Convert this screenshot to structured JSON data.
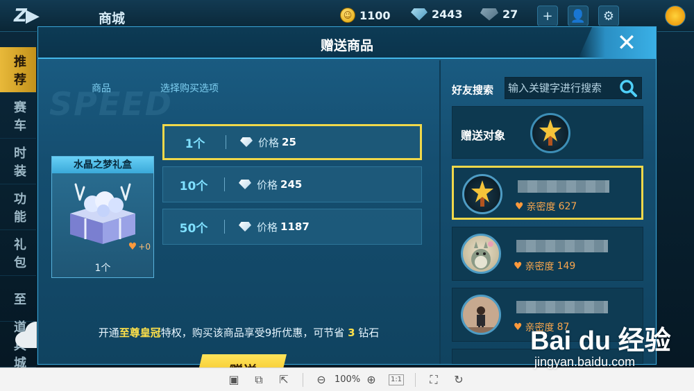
{
  "game": {
    "shop_title": "商城",
    "coins": "1100",
    "gems": "2443",
    "cards": "27",
    "left_menu": [
      "推荐",
      "赛车",
      "时装",
      "功能",
      "礼包",
      "至",
      "道具城"
    ]
  },
  "dialog": {
    "title": "赠送商品",
    "close_label": "✕",
    "col_item": "商品",
    "col_options": "选择购买选项",
    "item": {
      "name": "水晶之梦礼盒",
      "heart_bonus": "+0",
      "qty_label": "1个"
    },
    "options": [
      {
        "qty": "1个",
        "price_label": "价格",
        "price": "25",
        "selected": true
      },
      {
        "qty": "10个",
        "price_label": "价格",
        "price": "245",
        "selected": false
      },
      {
        "qty": "50个",
        "price_label": "价格",
        "price": "1187",
        "selected": false
      }
    ],
    "promo": {
      "pre": "开通",
      "vip": "至尊皇冠",
      "mid": "特权，购买该商品享受9折优惠，可节省",
      "save": "3",
      "post": "钻石"
    },
    "gift_button": "赠送",
    "search": {
      "label": "好友搜索",
      "placeholder": "输入关键字进行搜索"
    },
    "target_label": "赠送对象",
    "friends": [
      {
        "affinity_label": "亲密度",
        "affinity": "627",
        "selected": true
      },
      {
        "affinity_label": "亲密度",
        "affinity": "149",
        "selected": false
      },
      {
        "affinity_label": "亲密度",
        "affinity": "87",
        "selected": false
      }
    ]
  },
  "viewer": {
    "zoom": "100%",
    "actual_size": "1:1"
  },
  "watermark": {
    "brand": "Bai du 经验",
    "url": "jingyan.baidu.com"
  },
  "colors": {
    "accent_yellow": "#f0d84a",
    "dialog_blue": "#1b5f86",
    "affinity_orange": "#f9a64d"
  }
}
